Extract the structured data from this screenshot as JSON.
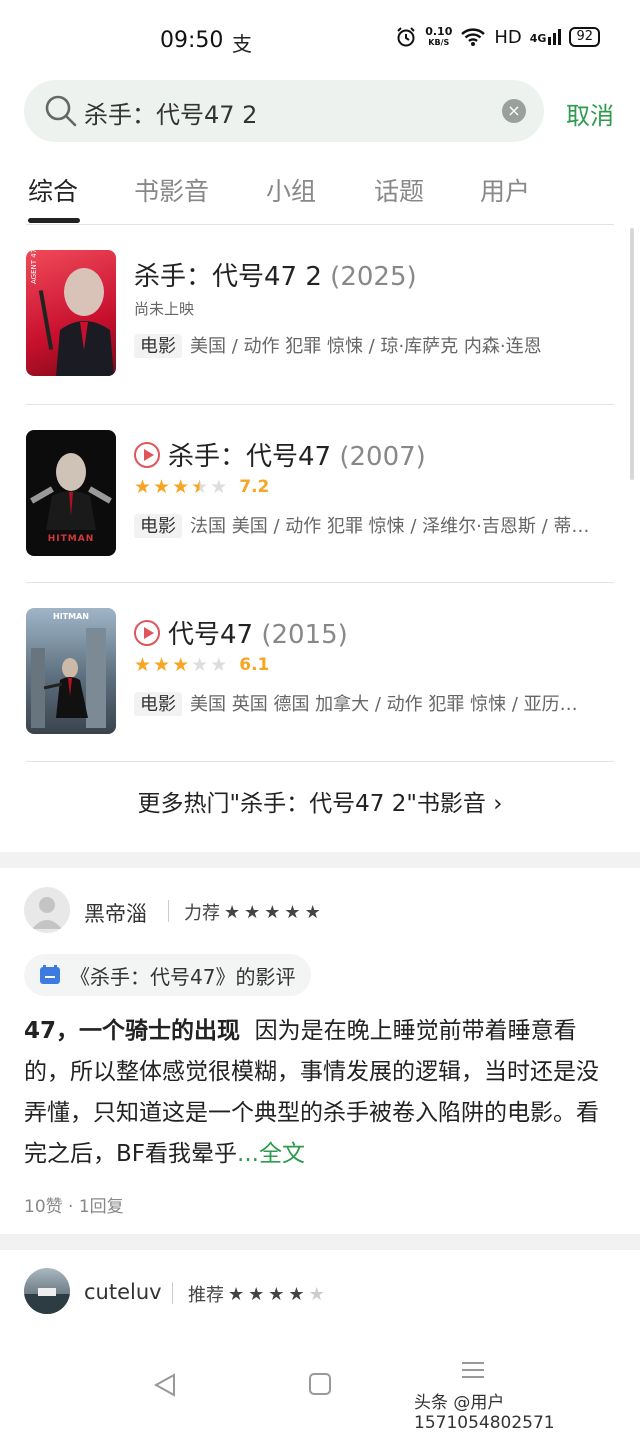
{
  "status": {
    "time": "09:50",
    "net_rate": "0.10",
    "net_unit": "KB/S",
    "hd": "HD",
    "signal": "4G",
    "battery": "92",
    "alipay": "支"
  },
  "search": {
    "query": "杀手：代号47 2",
    "cancel": "取消"
  },
  "tabs": [
    "综合",
    "书影音",
    "小组",
    "话题",
    "用户"
  ],
  "movies": [
    {
      "title": "杀手：代号47 2",
      "year": "(2025)",
      "status": "尚未上映",
      "tag": "电影",
      "meta": "美国 / 动作 犯罪 惊悚 / 琼·库萨克 内森·连恩",
      "playable": false
    },
    {
      "title": "杀手：代号47",
      "year": "(2007)",
      "rating": 3.5,
      "score": "7.2",
      "tag": "电影",
      "meta": "法国 美国 / 动作 犯罪 惊悚 / 泽维尔·吉恩斯 / 蒂…",
      "playable": true
    },
    {
      "title": "代号47",
      "year": "(2015)",
      "rating": 3,
      "score": "6.1",
      "tag": "电影",
      "meta": "美国 英国 德国 加拿大 / 动作 犯罪 惊悚 / 亚历…",
      "playable": true
    }
  ],
  "more_link": "更多热门\"杀手：代号47 2\"书影音",
  "reviews": [
    {
      "user": "黑帝淄",
      "rec_label": "力荐",
      "stars": 5,
      "chip": "《杀手：代号47》的影评",
      "headline": "47，一个骑士的出现",
      "text": "因为是在晚上睡觉前带着睡意看的，所以整体感觉很模糊，事情发展的逻辑，当时还是没弄懂，只知道这是一个典型的杀手被卷入陷阱的电影。看完之后，BF看我晕乎",
      "more": "...全文",
      "stats": "10赞 · 1回复"
    },
    {
      "user": "cuteluv",
      "rec_label": "推荐",
      "stars": 4
    }
  ],
  "poster_text": {
    "p1": "AGENT 47",
    "p2": "HITMAN",
    "p3": "HITMAN"
  },
  "watermark": "头条 @用户1571054802571",
  "colors": {
    "accent": "#2e9b4e",
    "star": "#f6a623",
    "play": "#e0555a"
  }
}
